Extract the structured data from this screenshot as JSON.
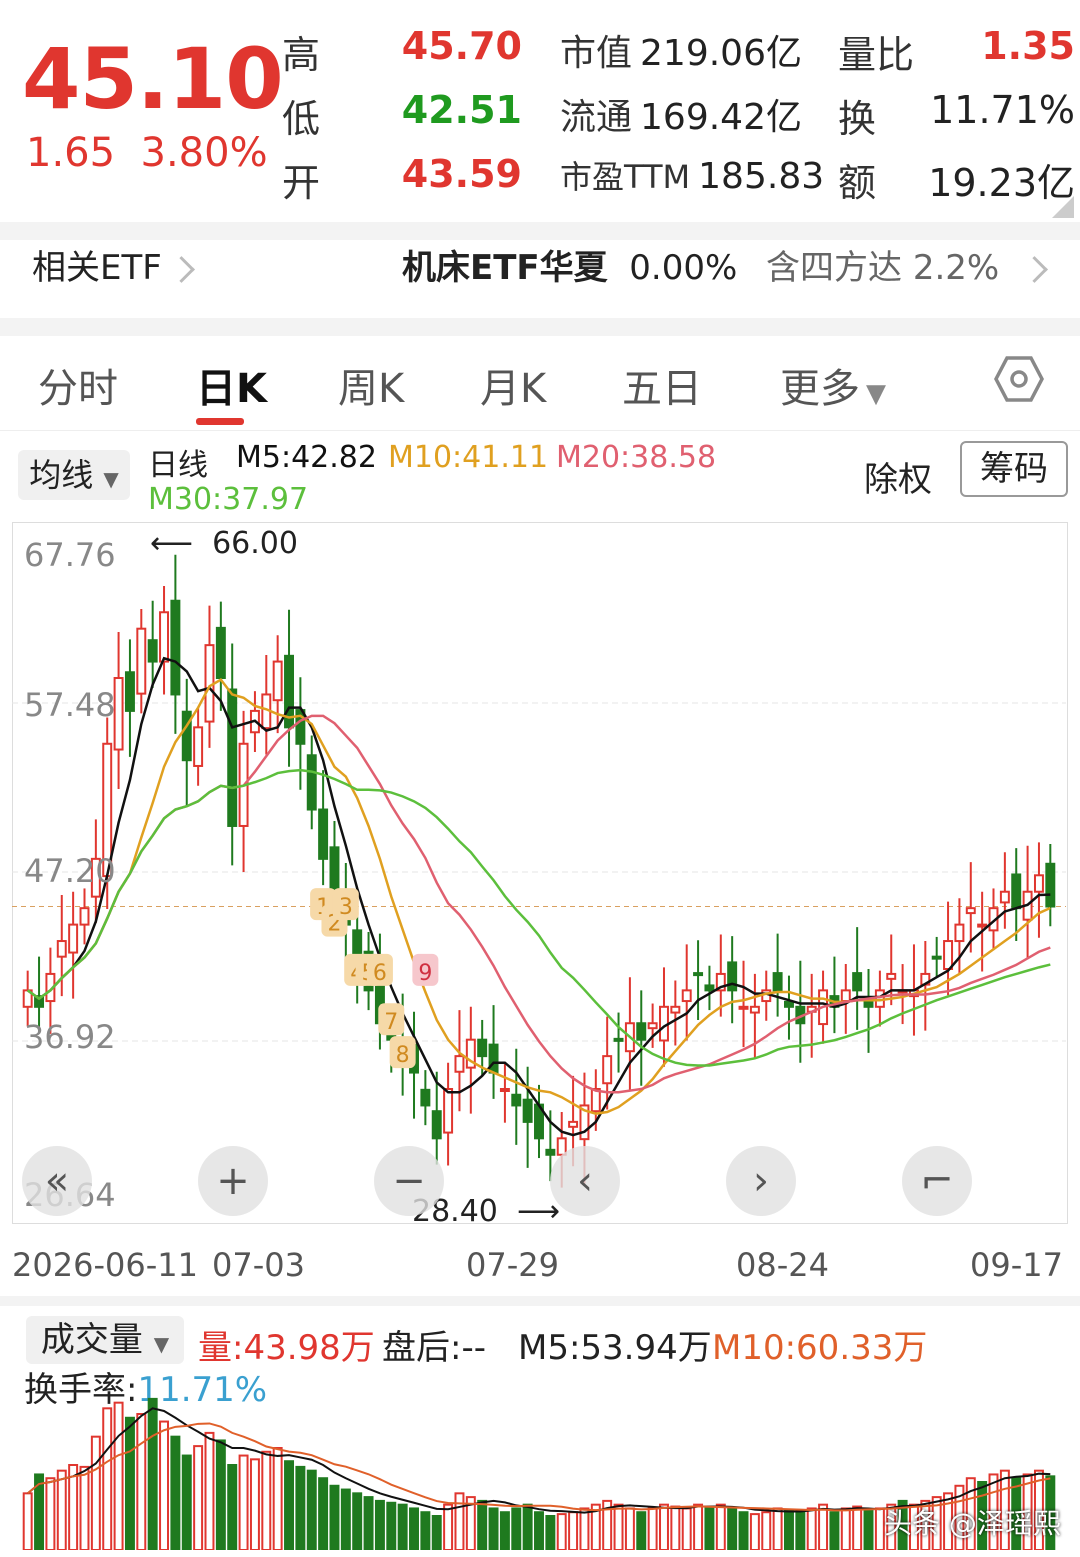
{
  "quote": {
    "price": "45.10",
    "change": "1.65",
    "change_pct": "3.80%",
    "high_label": "高",
    "high": "45.70",
    "low_label": "低",
    "low": "42.51",
    "open_label": "开",
    "open": "43.59",
    "mcap_label": "市值",
    "mcap": "219.06亿",
    "float_label": "流通",
    "float": "169.42亿",
    "pe_label": "市盈TTM",
    "pe": "185.83",
    "vr_label": "量比",
    "vr": "1.35",
    "turnover_label": "换",
    "turnover": "11.71%",
    "amount_label": "额",
    "amount": "19.23亿"
  },
  "etf": {
    "label": "相关ETF",
    "name": "机床ETF华夏",
    "name_pct": "0.00%",
    "holding": "含四方达",
    "holding_pct": "2.2%"
  },
  "tabs": [
    "分时",
    "日K",
    "周K",
    "月K",
    "五日",
    "更多"
  ],
  "active_tab": "日K",
  "ma_legend": {
    "pill": "均线",
    "kind": "日线",
    "m5": "M5:42.82",
    "m10": "M10:41.11",
    "m20": "M20:38.58",
    "m30": "M30:37.97",
    "exright": "除权",
    "chips": "筹码"
  },
  "colors": {
    "up": "#e0362f",
    "down": "#1f7a1f",
    "m5": "#111111",
    "m10": "#e0a020",
    "m20": "#e06070",
    "m30": "#5cbf3c"
  },
  "chart_data": {
    "type": "candlestick",
    "y_ticks": [
      "67.76",
      "57.48",
      "47.20",
      "36.92",
      "26.64"
    ],
    "ylim": [
      26.64,
      67.76
    ],
    "x_ticks": [
      "2026-06-11",
      "07-03",
      "07-29",
      "08-24",
      "09-17"
    ],
    "annotations": {
      "high_marker": "66.00",
      "low_marker": "28.40",
      "last_price_line": 45.1
    },
    "signals": [
      "1",
      "2",
      "3",
      "4",
      "5",
      "6",
      "7",
      "8",
      "9"
    ],
    "candles_ohl_c_close": [
      40,
      39,
      41,
      43,
      44,
      45,
      48,
      55,
      59,
      57,
      62,
      60,
      63,
      58,
      54,
      56,
      61,
      59,
      50,
      55,
      57,
      58,
      60,
      56,
      55,
      51,
      48,
      46,
      44,
      42,
      40,
      38,
      37,
      36,
      35,
      33,
      31,
      34,
      36,
      37,
      36,
      35,
      34,
      33,
      32,
      31,
      30,
      31,
      32,
      33,
      34,
      36,
      37,
      38,
      37,
      38,
      39,
      39,
      40,
      41,
      40,
      41,
      40,
      39,
      39,
      40,
      40,
      39,
      38,
      39,
      40,
      39,
      40,
      40,
      39,
      40,
      41,
      40,
      40,
      41,
      42,
      43,
      44,
      45,
      44,
      45,
      46,
      45,
      46,
      47,
      45.1
    ],
    "series": [
      {
        "name": "M5",
        "value": "42.82"
      },
      {
        "name": "M10",
        "value": "41.11"
      },
      {
        "name": "M20",
        "value": "38.58"
      },
      {
        "name": "M30",
        "value": "37.97"
      }
    ]
  },
  "volume": {
    "pill": "成交量",
    "vol": "量:43.98万",
    "after": "盘后:--",
    "m5": "M5:53.94万",
    "m10": "M10:60.33万",
    "turnover_label": "换手率:",
    "turnover": "11.71%",
    "bars": [
      30,
      40,
      38,
      42,
      45,
      44,
      60,
      75,
      78,
      70,
      72,
      80,
      68,
      60,
      50,
      55,
      62,
      58,
      45,
      50,
      48,
      52,
      54,
      47,
      44,
      42,
      38,
      34,
      32,
      30,
      28,
      26,
      25,
      24,
      22,
      20,
      18,
      24,
      30,
      28,
      26,
      22,
      20,
      22,
      24,
      20,
      18,
      19,
      20,
      22,
      24,
      26,
      24,
      22,
      20,
      22,
      24,
      23,
      22,
      24,
      22,
      24,
      22,
      20,
      19,
      20,
      22,
      21,
      20,
      22,
      24,
      20,
      22,
      23,
      21,
      22,
      24,
      26,
      24,
      26,
      28,
      30,
      34,
      38,
      36,
      40,
      42,
      38,
      40,
      42,
      39
    ],
    "watermark": "头条 @泽瑶熙"
  }
}
